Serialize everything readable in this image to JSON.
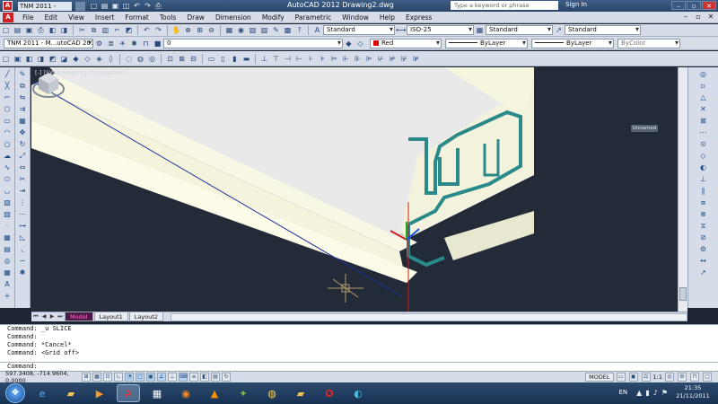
{
  "titlebar": {
    "app_icon": "A",
    "qa_dropdown": "TNM 2011 - Migrated fr...",
    "title": "AutoCAD 2012   Drawing2.dwg",
    "search_placeholder": "Type a keyword or phrase",
    "signin": "Sign In"
  },
  "menu": {
    "items": [
      "File",
      "Edit",
      "View",
      "Insert",
      "Format",
      "Tools",
      "Draw",
      "Dimension",
      "Modify",
      "Parametric",
      "Window",
      "Help",
      "Express"
    ]
  },
  "toolbar1": {
    "text_style": "Standard",
    "dim_style": "ISO-25",
    "table_style": "Standard",
    "mleader_style": "Standard"
  },
  "toolbar2": {
    "workspace": "TNM 2011 - M...utoCAD 201",
    "layer": "0",
    "color": "Red",
    "linetype": "ByLayer",
    "lineweight": "ByLayer",
    "plotstyle": "ByColor"
  },
  "viewport": {
    "label": "[-] [SW Isometric] [Conceptual]",
    "viewcube_label": "Unnamed",
    "ucs_x": "X",
    "ucs_y": "Y",
    "ucs_z": "Z"
  },
  "tabs": [
    "Model",
    "Layout1",
    "Layout2"
  ],
  "command_history": [
    "Command:  _u SLICE",
    "Command:",
    "Command: *Cancel*",
    "Command:  <Grid off>"
  ],
  "command_prompt": "Command:",
  "status": {
    "coords": "597.3408, -714.9604, 0.0000",
    "space": "MODEL",
    "scale": "1:1"
  },
  "taskbar": {
    "lang": "EN",
    "time": "21:35",
    "date": "21/11/2011"
  },
  "colors": {
    "accent_profile": "#2a8a8a",
    "body_fill": "#f3f3dd",
    "canvas_bg": "#232b39"
  }
}
